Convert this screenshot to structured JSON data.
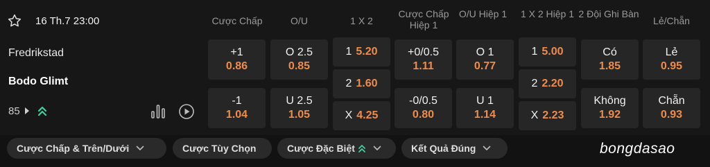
{
  "match": {
    "datetime": "16 Th.7 23:00",
    "home": "Fredrikstad",
    "away": "Bodo Glimt",
    "more_markets": "85"
  },
  "columns": [
    {
      "id": "handicap",
      "label": "Cược Chấp"
    },
    {
      "id": "ou",
      "label": "O/U"
    },
    {
      "id": "1x2",
      "label": "1 X 2"
    },
    {
      "id": "handicap_h1",
      "label": "Cược Chấp Hiệp 1"
    },
    {
      "id": "ou_h1",
      "label": "O/U Hiệp 1"
    },
    {
      "id": "1x2_h1",
      "label": "1 X 2 Hiệp 1"
    },
    {
      "id": "btts",
      "label": "2 Đội Ghi Bàn"
    },
    {
      "id": "oddeven",
      "label": "Lẻ/Chẵn"
    }
  ],
  "odds": {
    "handicap": [
      {
        "label": "+1",
        "odd": "0.86"
      },
      {
        "label": "-1",
        "odd": "1.04"
      }
    ],
    "ou": [
      {
        "label": "O 2.5",
        "odd": "0.85"
      },
      {
        "label": "U 2.5",
        "odd": "1.05"
      }
    ],
    "x12": [
      {
        "label": "1",
        "odd": "5.20"
      },
      {
        "label": "2",
        "odd": "1.60"
      },
      {
        "label": "X",
        "odd": "4.25"
      }
    ],
    "handicap_h1": [
      {
        "label": "+0/0.5",
        "odd": "1.11"
      },
      {
        "label": "-0/0.5",
        "odd": "0.80"
      }
    ],
    "ou_h1": [
      {
        "label": "O 1",
        "odd": "0.77"
      },
      {
        "label": "U 1",
        "odd": "1.14"
      }
    ],
    "x12_h1": [
      {
        "label": "1",
        "odd": "5.00"
      },
      {
        "label": "2",
        "odd": "2.20"
      },
      {
        "label": "X",
        "odd": "2.23"
      }
    ],
    "btts": [
      {
        "label": "Có",
        "odd": "1.85"
      },
      {
        "label": "Không",
        "odd": "1.92"
      }
    ],
    "oddeven": [
      {
        "label": "Lẻ",
        "odd": "0.95"
      },
      {
        "label": "Chẵn",
        "odd": "0.93"
      }
    ]
  },
  "tabs": [
    {
      "label": "Cược Chấp & Trên/Dưới",
      "icon": "chevron-down-icon"
    },
    {
      "label": "Cược Tùy Chọn",
      "icon": ""
    },
    {
      "label": "Cược Đặc Biệt",
      "icon": "double-chevron-up-icon"
    },
    {
      "label": "Kết Quả Đúng",
      "icon": "chevron-down-icon"
    }
  ],
  "watermark": "bongdasao",
  "colors": {
    "background": "#171717",
    "cell": "#262626",
    "odd": "#f08c4a",
    "accent": "#3fd0a0"
  }
}
